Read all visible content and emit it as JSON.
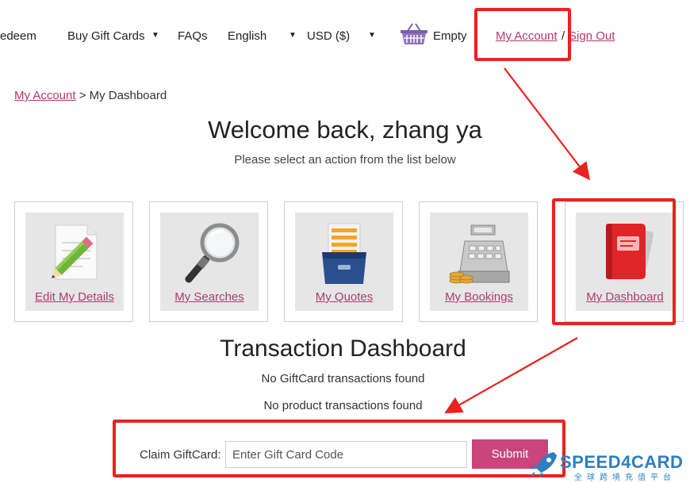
{
  "nav": {
    "redeem": "edeem",
    "buy_gift_cards": "Buy Gift Cards",
    "faqs": "FAQs",
    "language": "English",
    "currency": "USD ($)",
    "caret": "▼",
    "cart": "Empty",
    "my_account": "My Account",
    "separator": "/",
    "sign_out": "Sign Out"
  },
  "breadcrumb": {
    "link": "My Account",
    "rest": " > My Dashboard"
  },
  "welcome": {
    "title": "Welcome back, zhang ya",
    "subtitle": "Please select an action from the list below"
  },
  "tiles": [
    {
      "label": "Edit My Details",
      "icon": "edit-pencil-icon"
    },
    {
      "label": "My Searches",
      "icon": "magnifier-icon"
    },
    {
      "label": "My Quotes",
      "icon": "file-drawer-icon"
    },
    {
      "label": "My Bookings",
      "icon": "cash-register-icon"
    },
    {
      "label": "My Dashboard",
      "icon": "red-folder-icon"
    }
  ],
  "transactions": {
    "title": "Transaction Dashboard",
    "no_giftcard": "No GiftCard transactions found",
    "no_product": "No product transactions found"
  },
  "claim": {
    "label": "Claim GiftCard:",
    "placeholder": "Enter Gift Card Code",
    "submit": "Submit"
  },
  "watermark": {
    "brand": "SPEED4CARD",
    "sub": "全球跨境充值平台"
  },
  "colors": {
    "link": "#b03a6e",
    "button": "#c9457b",
    "annotation": "#e8231d",
    "watermark": "#2e7fc1"
  }
}
